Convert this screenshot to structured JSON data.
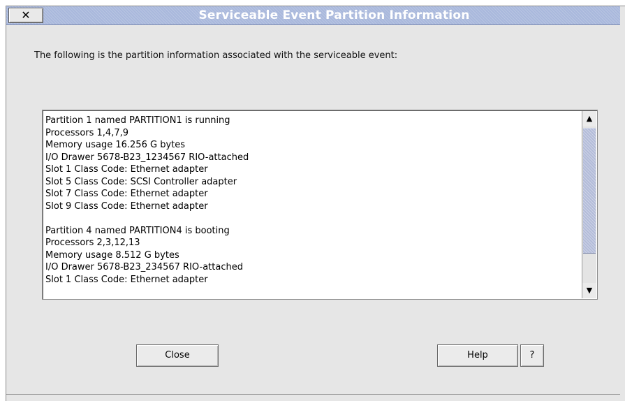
{
  "window": {
    "title": "Serviceable Event Partition Information",
    "close_glyph": "✕"
  },
  "intro_text": "The following is the partition information associated with the serviceable event:",
  "details": {
    "lines": [
      "Partition 1 named PARTITION1 is running",
      "Processors 1,4,7,9",
      "Memory usage 16.256 G bytes",
      "I/O Drawer 5678-B23_1234567 RIO-attached",
      "Slot 1 Class Code: Ethernet adapter",
      "Slot 5 Class Code: SCSI Controller adapter",
      "Slot 7 Class Code: Ethernet adapter",
      "Slot 9 Class Code: Ethernet adapter",
      "",
      "Partition 4 named PARTITION4 is booting",
      "Processors 2,3,12,13",
      "Memory usage 8.512 G bytes",
      "I/O Drawer 5678-B23_234567 RIO-attached",
      "Slot 1 Class Code: Ethernet adapter"
    ]
  },
  "scrollbar": {
    "up_icon": "▲",
    "down_icon": "▼"
  },
  "buttons": {
    "close_label": "Close",
    "help_label": "Help",
    "question_label": "?"
  },
  "colors": {
    "titlebar": "#a9b8dc",
    "dialog_background": "#e6e6e6"
  }
}
